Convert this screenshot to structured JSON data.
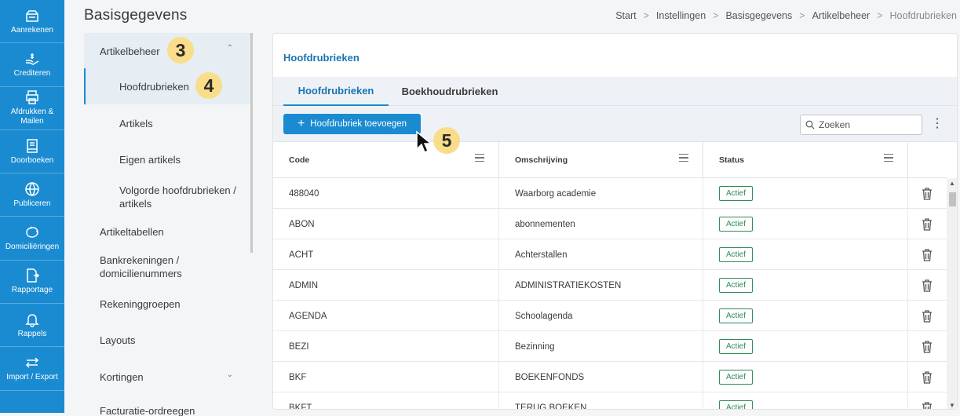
{
  "rail": [
    {
      "label": "Aanrekenen",
      "icon": "invoice-icon"
    },
    {
      "label": "Crediteren",
      "icon": "credit-hand-icon"
    },
    {
      "label": "Afdrukken & Mailen",
      "icon": "printer-icon"
    },
    {
      "label": "Doorboeken",
      "icon": "ledger-icon"
    },
    {
      "label": "Publiceren",
      "icon": "globe-icon"
    },
    {
      "label": "Domiciliëringen",
      "icon": "piggy-bank-icon"
    },
    {
      "label": "Rapportage",
      "icon": "report-export-icon"
    },
    {
      "label": "Rappels",
      "icon": "bell-icon"
    },
    {
      "label": "Import / Export",
      "icon": "arrows-swap-icon"
    }
  ],
  "header": {
    "title": "Basisgegevens",
    "breadcrumb": [
      "Start",
      "Instellingen",
      "Basisgegevens",
      "Artikelbeheer",
      "Hoofdrubrieken"
    ]
  },
  "subnav": {
    "items": [
      {
        "label": "Artikelbeheer"
      },
      {
        "label": "Hoofdrubrieken"
      },
      {
        "label": "Artikels"
      },
      {
        "label": "Eigen artikels"
      },
      {
        "label": "Volgorde hoofdrubrieken / artikels"
      },
      {
        "label": "Artikeltabellen"
      },
      {
        "label": "Bankrekeningen / domicilienummers"
      },
      {
        "label": "Rekeninggroepen"
      },
      {
        "label": "Layouts"
      },
      {
        "label": "Kortingen"
      },
      {
        "label": "Facturatie-ordreegen"
      }
    ]
  },
  "steps": {
    "s3": "3",
    "s4": "4",
    "s5": "5"
  },
  "card": {
    "title": "Hoofdrubrieken",
    "tabs": [
      "Hoofdrubrieken",
      "Boekhoudrubrieken"
    ],
    "add_button": "Hoofdrubriek toevoegen",
    "search_placeholder": "Zoeken",
    "columns": [
      "Code",
      "Omschrijving",
      "Status"
    ],
    "rows": [
      {
        "code": "488040",
        "omschrijving": "Waarborg academie",
        "status": "Actief"
      },
      {
        "code": "ABON",
        "omschrijving": "abonnementen",
        "status": "Actief"
      },
      {
        "code": "ACHT",
        "omschrijving": "Achterstallen",
        "status": "Actief"
      },
      {
        "code": "ADMIN",
        "omschrijving": "ADMINISTRATIEKOSTEN",
        "status": "Actief"
      },
      {
        "code": "AGENDA",
        "omschrijving": "Schoolagenda",
        "status": "Actief"
      },
      {
        "code": "BEZI",
        "omschrijving": "Bezinning",
        "status": "Actief"
      },
      {
        "code": "BKF",
        "omschrijving": "BOEKENFONDS",
        "status": "Actief"
      },
      {
        "code": "BKFT",
        "omschrijving": "TERUG BOEKEN",
        "status": "Actief"
      }
    ]
  },
  "colors": {
    "accent": "#1a8bd0",
    "active_status": "#2e8b57",
    "step_badge": "#fadd8a"
  }
}
